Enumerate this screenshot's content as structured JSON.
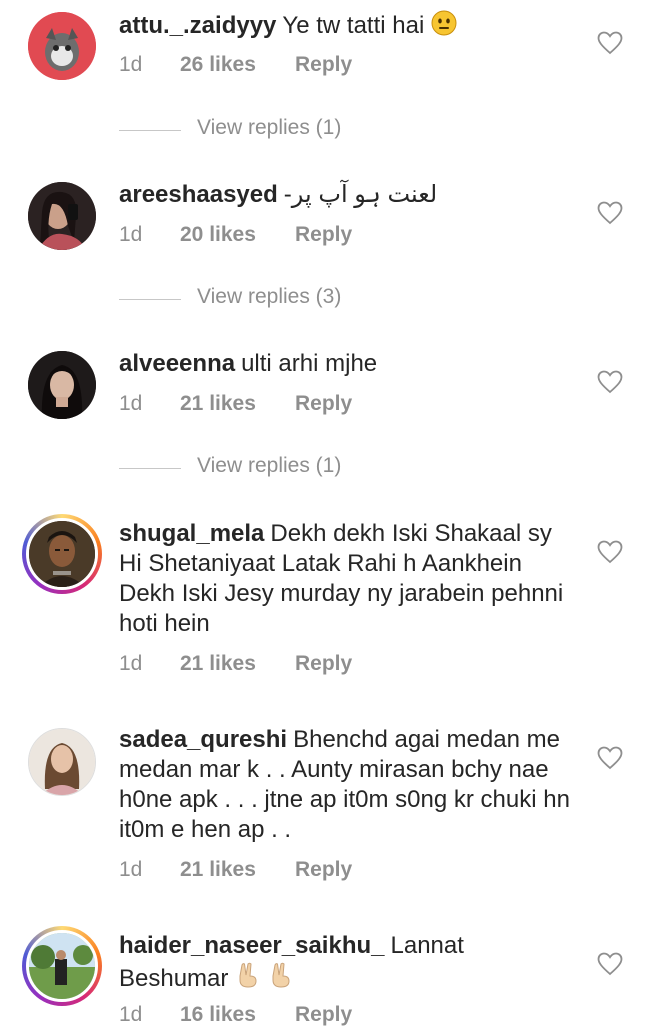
{
  "comments": [
    {
      "username": "attu._.zaidyyy",
      "text": "Ye tw tatti hai",
      "age": "1d",
      "likes": "26 likes",
      "reply": "Reply",
      "view_replies": "View replies (1)"
    },
    {
      "username": "areeshaasyed",
      "text": "لعنت ہو آپ پر-",
      "age": "1d",
      "likes": "20 likes",
      "reply": "Reply",
      "view_replies": "View replies (3)"
    },
    {
      "username": "alveeenna",
      "text": "ulti arhi mjhe",
      "age": "1d",
      "likes": "21 likes",
      "reply": "Reply",
      "view_replies": "View replies (1)"
    },
    {
      "username": "shugal_mela",
      "text": "Dekh dekh Iski Shakaal sy Hi Shetaniyaat Latak Rahi h Aankhein Dekh Iski Jesy murday ny jarabein pehnni hoti hein",
      "age": "1d",
      "likes": "21 likes",
      "reply": "Reply"
    },
    {
      "username": "sadea_qureshi",
      "text": "Bhenchd agai medan me medan mar k . . Aunty mirasan bchy nae h0ne apk . . . jtne ap it0m s0ng kr chuki hn it0m e hen ap . .",
      "age": "1d",
      "likes": "21 likes",
      "reply": "Reply"
    },
    {
      "username": "haider_naseer_saikhu_",
      "text": "Lannat Beshumar",
      "age": "1d",
      "likes": "16 likes",
      "reply": "Reply"
    }
  ],
  "colors": {
    "text": "#262626",
    "secondary": "#8e8e8e",
    "divider": "#c7c7c7"
  },
  "icons": {
    "like": "heart-outline-icon",
    "neutral_face": "neutral-face-emoji",
    "victory_hand": "victory-hand-emoji"
  }
}
